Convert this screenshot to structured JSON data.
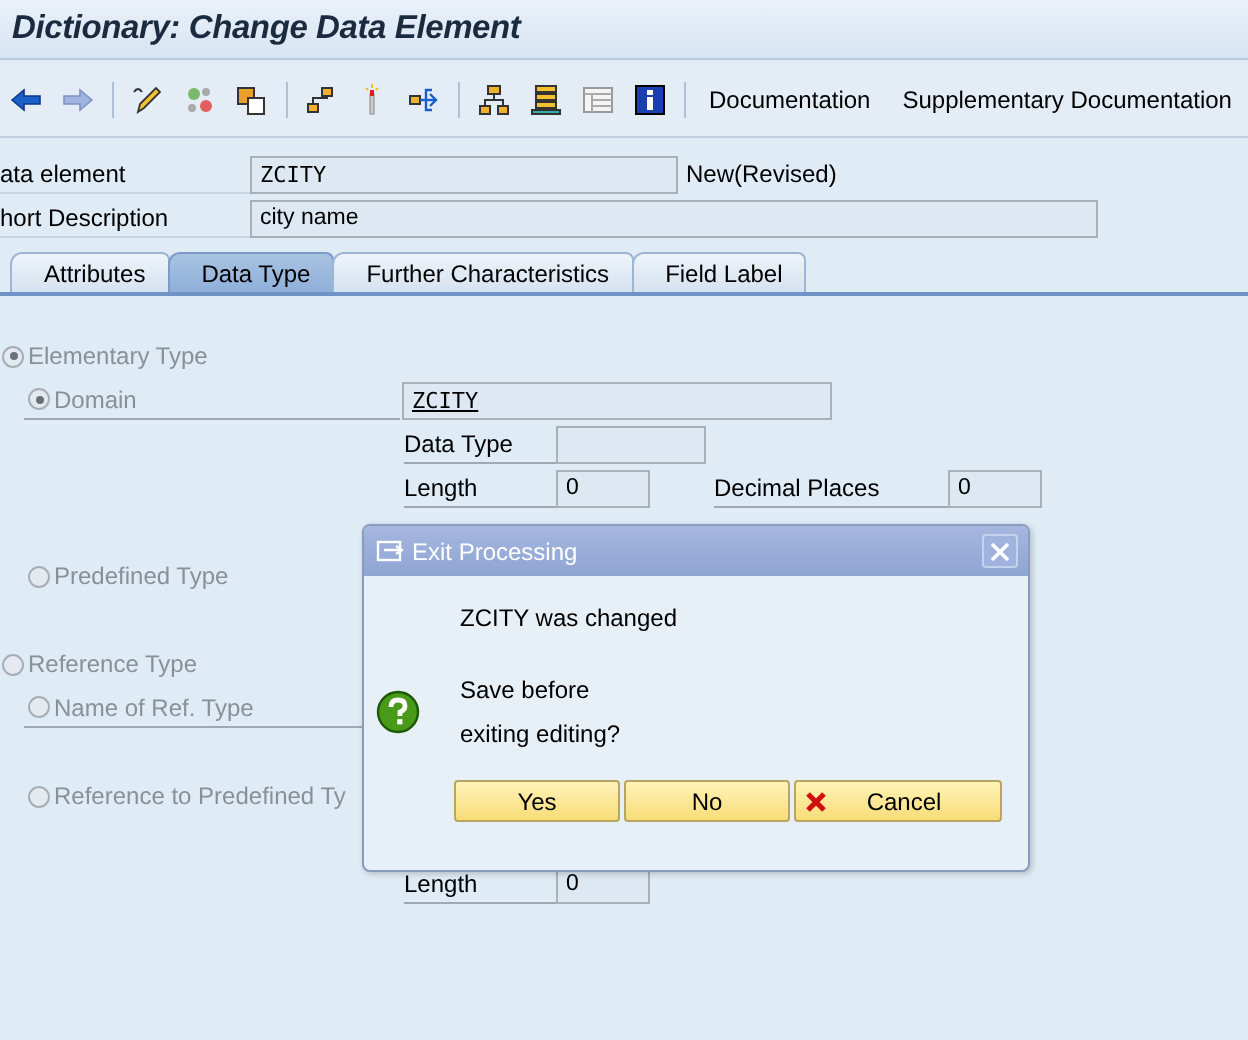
{
  "window": {
    "title": "Dictionary: Change Data Element"
  },
  "toolbar": {
    "buttons": [
      {
        "label": "Documentation"
      },
      {
        "label": "Supplementary Documentation"
      }
    ]
  },
  "header": {
    "data_element": {
      "label": "ata element",
      "value": "ZCITY",
      "status": "New(Revised)"
    },
    "short_description": {
      "label": "hort Description",
      "value": "city name"
    }
  },
  "tabs": [
    {
      "label": "Attributes",
      "selected": false
    },
    {
      "label": "Data Type",
      "selected": true
    },
    {
      "label": "Further Characteristics",
      "selected": false
    },
    {
      "label": "Field Label",
      "selected": false
    }
  ],
  "data_type": {
    "elementary_type": {
      "label": "Elementary Type",
      "selected": true,
      "disabled": true
    },
    "domain": {
      "label": "Domain",
      "selected": true,
      "disabled": true,
      "value": "ZCITY"
    },
    "data_type_field": {
      "label": "Data Type"
    },
    "length": {
      "label": "Length",
      "value": "0"
    },
    "decimal_places": {
      "label": "Decimal Places",
      "value": "0"
    },
    "predefined_type": {
      "label": "Predefined Type",
      "selected": false,
      "disabled": true
    },
    "reference_type": {
      "label": "Reference Type",
      "selected": false,
      "disabled": true
    },
    "name_of_ref_type": {
      "label": "Name of Ref. Type",
      "selected": false,
      "disabled": true
    },
    "reference_to_predefined": {
      "label": "Reference to Predefined Ty",
      "selected": false,
      "disabled": true
    },
    "ref_length": {
      "label": "Length",
      "value": "0"
    }
  },
  "dialog": {
    "title": "Exit Processing",
    "message": "ZCITY was changed",
    "question": [
      "Save before",
      "exiting editing?"
    ],
    "buttons": [
      {
        "label": "Yes",
        "kind": "plain"
      },
      {
        "label": "No",
        "kind": "plain"
      },
      {
        "label": "Cancel",
        "kind": "cancel"
      }
    ]
  }
}
